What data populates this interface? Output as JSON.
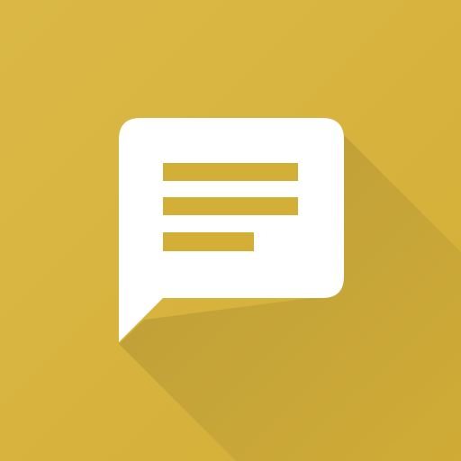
{
  "icon": {
    "name": "chat-message-icon",
    "background_color": "#D4AF37",
    "background_highlight": "#DBB846",
    "bubble_color": "#FFFFFF",
    "line_color": "#D4AF37",
    "shadow_color": "#000000",
    "shadow_opacity": 0.14
  }
}
